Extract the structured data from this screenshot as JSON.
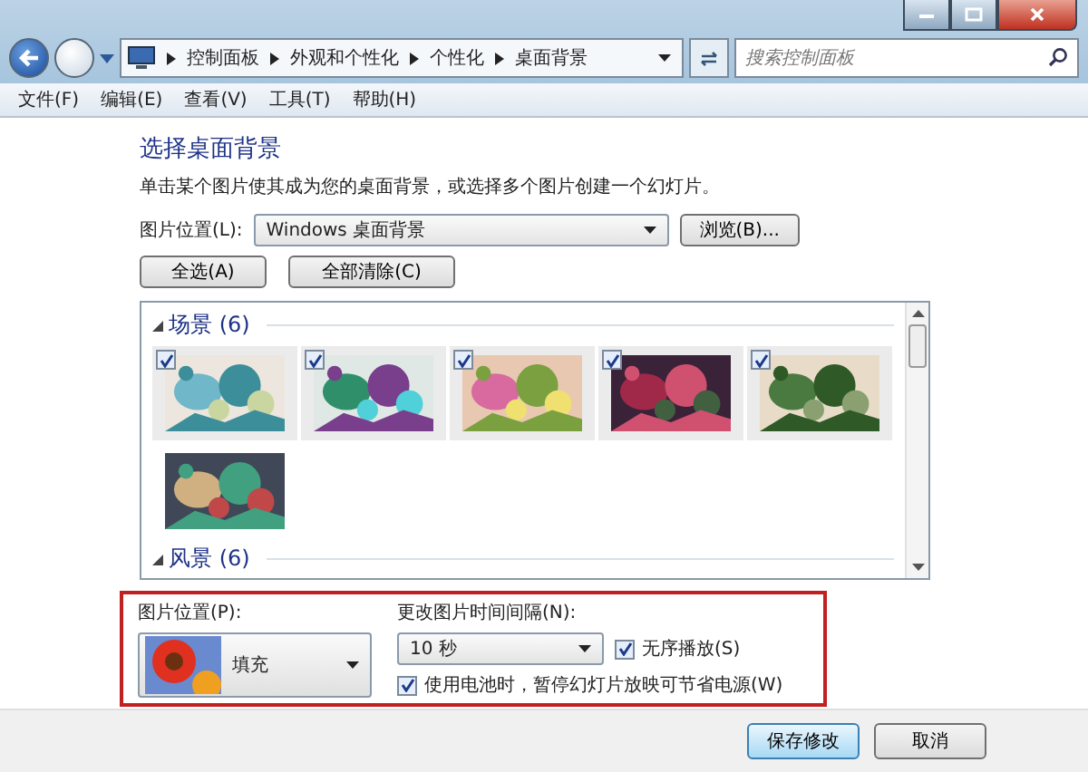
{
  "address_bar": {
    "crumbs": [
      "控制面板",
      "外观和个性化",
      "个性化",
      "桌面背景"
    ]
  },
  "search": {
    "placeholder": "搜索控制面板"
  },
  "menu": [
    "文件(F)",
    "编辑(E)",
    "查看(V)",
    "工具(T)",
    "帮助(H)"
  ],
  "heading": "选择桌面背景",
  "description": "单击某个图片使其成为您的桌面背景，或选择多个图片创建一个幻灯片。",
  "location": {
    "label": "图片位置(L):",
    "value": "Windows 桌面背景",
    "browse": "浏览(B)..."
  },
  "select_buttons": [
    "全选(A)",
    "全部清除(C)"
  ],
  "groups": [
    {
      "title": "场景 (6)",
      "expanded": true,
      "items": [
        {
          "kind": "picture",
          "checked": true
        },
        {
          "kind": "picture",
          "checked": true
        },
        {
          "kind": "picture",
          "checked": true
        },
        {
          "kind": "picture",
          "checked": true
        },
        {
          "kind": "picture",
          "checked": true
        },
        {
          "kind": "picture",
          "checked": false
        }
      ]
    },
    {
      "title": "风景 (6)",
      "expanded": true
    }
  ],
  "position": {
    "label": "图片位置(P):",
    "value": "填充"
  },
  "interval": {
    "label": "更改图片时间间隔(N):",
    "value": "10 秒"
  },
  "shuffle": {
    "label": "无序播放(S)",
    "checked": true
  },
  "battery": {
    "label": "使用电池时，暂停幻灯片放映可节省电源(W)",
    "checked": true
  },
  "buttons": [
    "保存修改",
    "取消"
  ]
}
